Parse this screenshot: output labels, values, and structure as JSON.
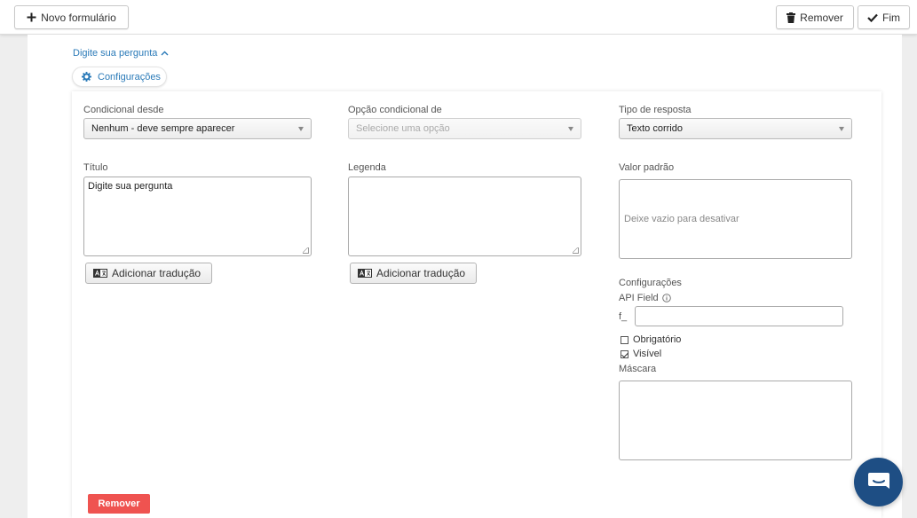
{
  "toolbar": {
    "new_form_label": "Novo formulário",
    "remove_label": "Remover",
    "finish_label": "Fim"
  },
  "question": {
    "title_link": "Digite sua pergunta",
    "config_tab_label": "Configurações"
  },
  "fields": {
    "conditional_since": {
      "label": "Condicional desde",
      "value": "Nenhum - deve sempre aparecer"
    },
    "conditional_option": {
      "label": "Opção condicional de",
      "placeholder": "Selecione uma opção"
    },
    "answer_type": {
      "label": "Tipo de resposta",
      "value": "Texto corrido"
    },
    "title": {
      "label": "Título",
      "value": "Digite sua pergunta"
    },
    "caption": {
      "label": "Legenda",
      "value": ""
    },
    "default_value": {
      "label": "Valor padrão",
      "placeholder": "Deixe vazio para desativar"
    },
    "add_translation_label": "Adicionar tradução"
  },
  "settings": {
    "heading": "Configurações",
    "api_field_label": "API Field",
    "api_prefix": "f_",
    "api_value": "",
    "required_label": "Obrigatório",
    "required_checked": false,
    "visible_label": "Visível",
    "visible_checked": true,
    "mask_label": "Máscara",
    "mask_value": ""
  },
  "footer": {
    "remove_label": "Remover"
  },
  "colors": {
    "link_blue": "#2a7ab8",
    "danger_red": "#ef5350",
    "chat_navy": "#1e4e84"
  }
}
